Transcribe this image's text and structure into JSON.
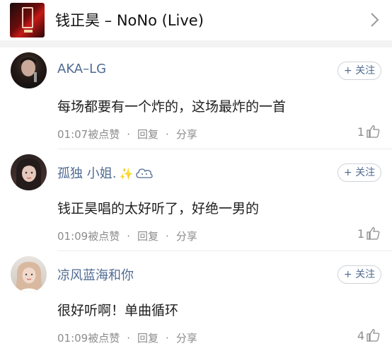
{
  "song": {
    "title": "钱正昊 – NoNo (Live)"
  },
  "comments": [
    {
      "username": "AKA–LG",
      "text": "每场都要有一个炸的，这场最炸的一首",
      "time": "01:07",
      "like_label": "被点赞",
      "reply": "回复",
      "share": "分享",
      "likes": "1",
      "follow": "+ 关注"
    },
    {
      "username": "孤独  小姐.",
      "text": "钱正昊唱的太好听了，好绝一男的",
      "time": "01:09",
      "like_label": "被点赞",
      "reply": "回复",
      "share": "分享",
      "likes": "1",
      "follow": "+ 关注"
    },
    {
      "username": "凉风蓝海和你",
      "text": "很好听啊！单曲循环",
      "time": "01:09",
      "like_label": "被点赞",
      "reply": "回复",
      "share": "分享",
      "likes": "4",
      "follow": "+ 关注"
    }
  ],
  "icons": {
    "chevron": "chevron-right-icon",
    "thumb": "thumbs-up-icon",
    "sparkle": "sparkle-icon",
    "cloud": "cloud-icon"
  },
  "colors": {
    "username": "#4f6b92",
    "meta": "#8c8c8c",
    "text": "#1e1e1e"
  }
}
